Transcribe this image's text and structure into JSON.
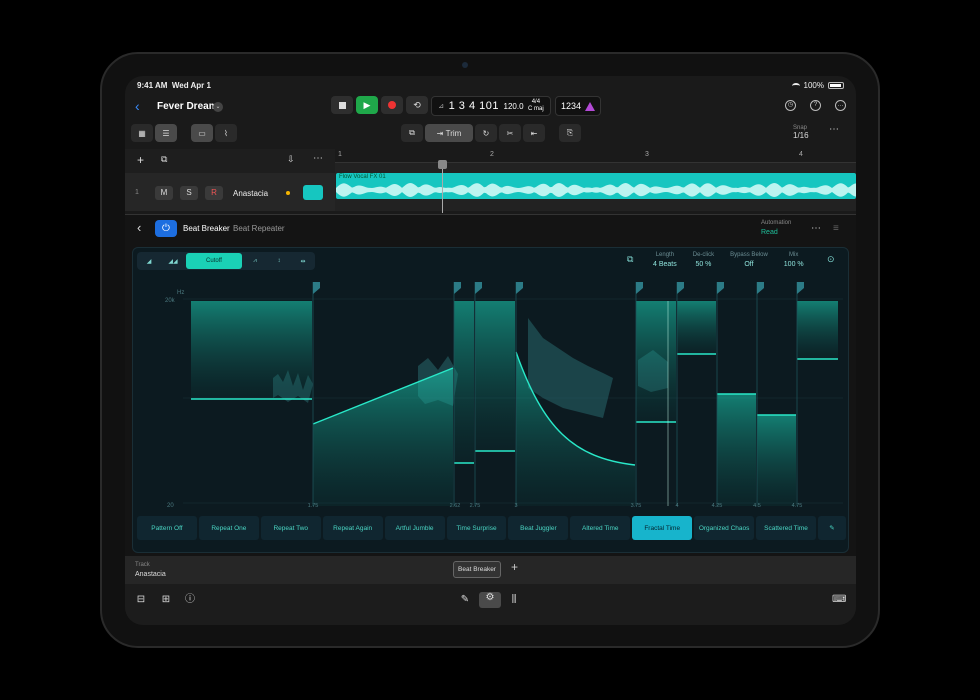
{
  "status": {
    "time": "9:41 AM",
    "date": "Wed Apr 1",
    "battery": "100%"
  },
  "project": {
    "title": "Fever Dream"
  },
  "lcd": {
    "position": "1 3 4 101",
    "tempo": "120.0",
    "signature": "4/4",
    "key": "C maj",
    "count_in": "1234"
  },
  "toolbar": {
    "trim_label": "Trim",
    "snap_label": "Snap",
    "snap_value": "1/16"
  },
  "ruler": {
    "bars": [
      "1",
      "2",
      "3",
      "4"
    ]
  },
  "track": {
    "number": "1",
    "mute": "M",
    "solo": "S",
    "record": "R",
    "name": "Anastacia",
    "region_label": "Flow Vocal FX 01"
  },
  "plugin": {
    "name": "Beat Breaker",
    "preset": "Beat Repeater",
    "automation_label": "Automation",
    "automation_value": "Read"
  },
  "beat_breaker": {
    "mode_selected": "Cutoff",
    "params": [
      {
        "label": "Length",
        "value": "4 Beats"
      },
      {
        "label": "De-click",
        "value": "50 %"
      },
      {
        "label": "Bypass Below",
        "value": "Off"
      },
      {
        "label": "Mix",
        "value": "100 %"
      }
    ],
    "hz_label": "Hz",
    "y_top": "20k",
    "y_bottom": "20",
    "x_labels": [
      "1.75",
      "2.62",
      "2.75",
      "3",
      "3.75",
      "4",
      "4.25",
      "4.5",
      "4.75"
    ],
    "presets": [
      "Pattern Off",
      "Repeat One",
      "Repeat Two",
      "Repeat Again",
      "Artful Jumble",
      "Time Surprise",
      "Beat Juggler",
      "Altered Time",
      "Fractal Time",
      "Organized Chaos",
      "Scattered Time"
    ],
    "preset_selected": "Fractal Time"
  },
  "bottom": {
    "track_label": "Track",
    "track_name": "Anastacia",
    "tab_label": "Beat Breaker"
  },
  "colors": {
    "accent": "#1ad1b6",
    "region": "#16c6c0",
    "play": "#1fa84a",
    "record": "#e33333",
    "power": "#1d6ee0"
  }
}
